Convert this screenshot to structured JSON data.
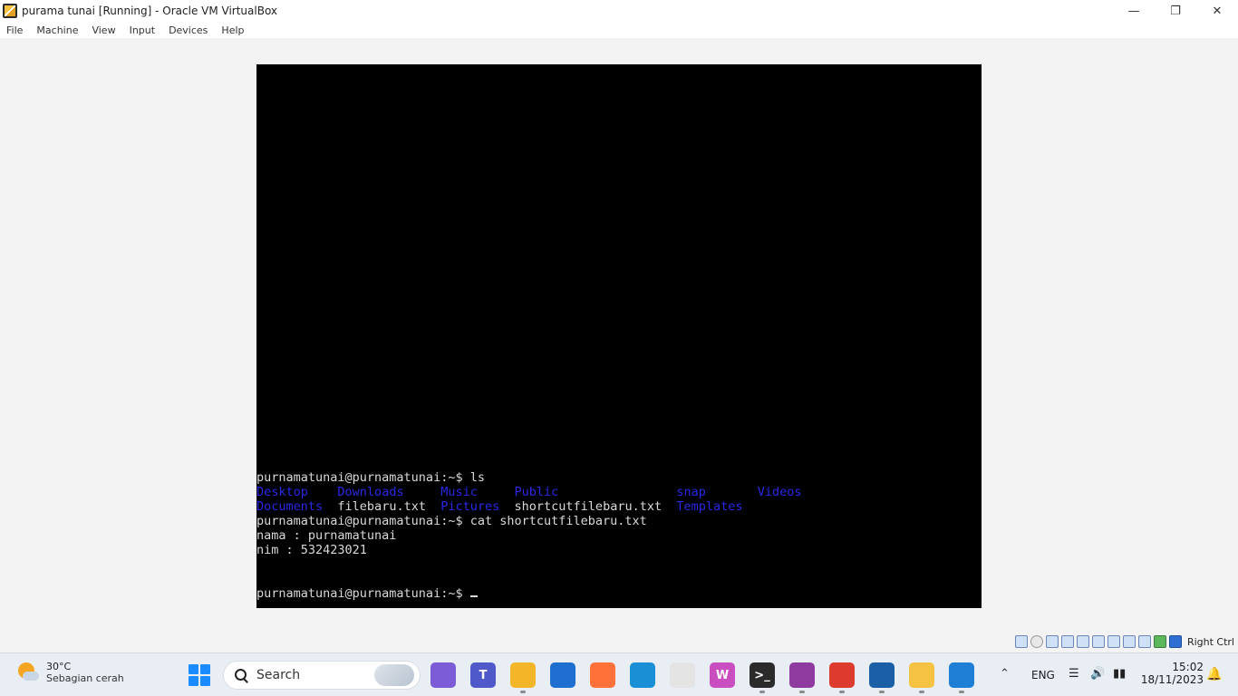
{
  "window": {
    "title": "purama tunai [Running] - Oracle VM VirtualBox",
    "minimize_icon": "minimize-icon",
    "maximize_icon": "restore-icon",
    "close_icon": "close-icon"
  },
  "menu": [
    "File",
    "Machine",
    "View",
    "Input",
    "Devices",
    "Help"
  ],
  "terminal": {
    "prompt": "purnamatunai@purnamatunai:~$",
    "lines": [
      {
        "type": "cmd",
        "text": "purnamatunai@purnamatunai:~$ ls"
      },
      {
        "type": "ls",
        "items": [
          {
            "text": "Desktop",
            "dir": true
          },
          {
            "text": "Downloads",
            "dir": true
          },
          {
            "text": "Music",
            "dir": true
          },
          {
            "text": "Public",
            "dir": true
          },
          {
            "text": "snap",
            "dir": true
          },
          {
            "text": "Videos",
            "dir": true
          }
        ]
      },
      {
        "type": "ls",
        "items": [
          {
            "text": "Documents",
            "dir": true
          },
          {
            "text": "filebaru.txt",
            "dir": false
          },
          {
            "text": "Pictures",
            "dir": true
          },
          {
            "text": "shortcutfilebaru.txt",
            "dir": false
          },
          {
            "text": "Templates",
            "dir": true
          }
        ]
      },
      {
        "type": "cmd",
        "text": "purnamatunai@purnamatunai:~$ cat shortcutfilebaru.txt"
      },
      {
        "type": "out",
        "text": "nama : purnamatunai"
      },
      {
        "type": "out",
        "text": "nim : 532423021"
      },
      {
        "type": "out",
        "text": ""
      },
      {
        "type": "out",
        "text": ""
      },
      {
        "type": "prompt",
        "text": "purnamatunai@purnamatunai:~$ "
      }
    ]
  },
  "status_bar": {
    "host_key": "Right Ctrl"
  },
  "taskbar": {
    "weather": {
      "temp": "30°C",
      "condition": "Sebagian cerah"
    },
    "search_label": "Search",
    "apps": [
      {
        "name": "copilot-icon",
        "label": "",
        "color": "#7b5cd6"
      },
      {
        "name": "teams-icon",
        "label": "T",
        "color": "#5059c9"
      },
      {
        "name": "file-explorer-icon",
        "label": "",
        "color": "#f2b628"
      },
      {
        "name": "app-icon",
        "label": "",
        "color": "#1f6fd1"
      },
      {
        "name": "firefox-icon",
        "label": "",
        "color": "#ff7139"
      },
      {
        "name": "edge-icon",
        "label": "",
        "color": "#1a8fd6"
      },
      {
        "name": "snipping-tool-icon",
        "label": "",
        "color": "#e4e4e4"
      },
      {
        "name": "wps-icon",
        "label": "W",
        "color": "#c94ec0"
      },
      {
        "name": "terminal-icon",
        "label": ">_",
        "color": "#2b2b2b"
      },
      {
        "name": "winrar-icon",
        "label": "",
        "color": "#8e3a9e"
      },
      {
        "name": "chrome-icon",
        "label": "",
        "color": "#de3b2f"
      },
      {
        "name": "virtualbox-icon",
        "label": "",
        "color": "#1b5fa6"
      },
      {
        "name": "virtualbox-vm-icon",
        "label": "",
        "color": "#f5c242"
      },
      {
        "name": "photos-icon",
        "label": "",
        "color": "#1f7fd6"
      }
    ],
    "tray": {
      "language": "ENG",
      "time": "15:02",
      "date": "18/11/2023"
    }
  }
}
